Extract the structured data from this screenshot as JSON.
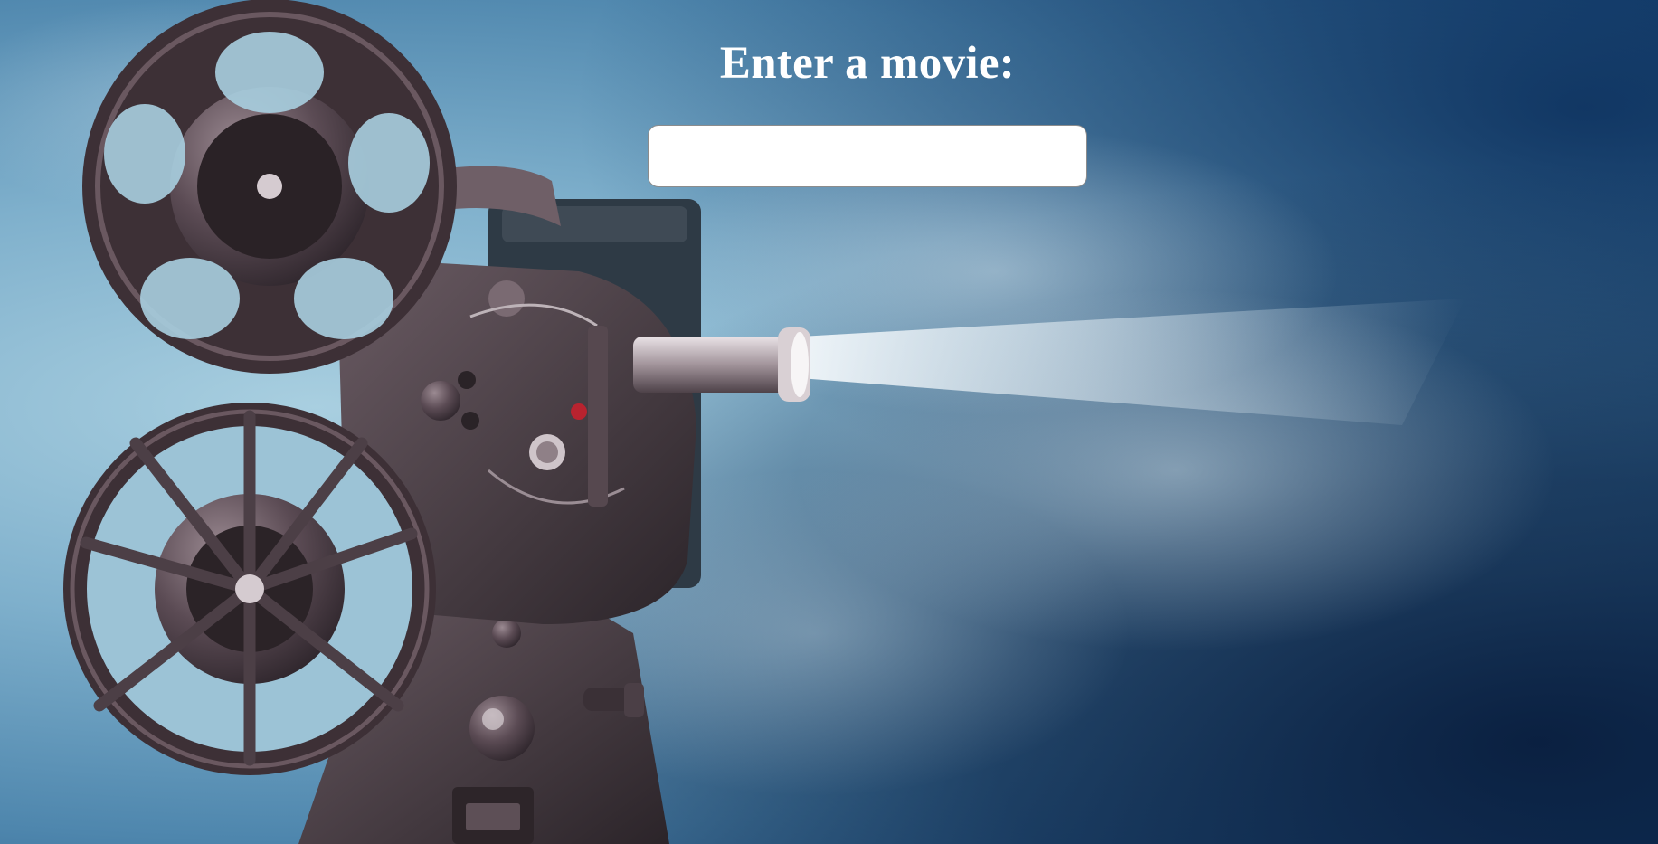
{
  "page": {
    "heading": "Enter a movie:"
  },
  "search": {
    "value": "",
    "placeholder": ""
  },
  "background": {
    "subject": "film-projector-photo",
    "colors": {
      "haze": "#8fbfd6",
      "deep_blue": "#0d2f5c",
      "metal": "#4a3d44",
      "beam": "#e7eef3"
    }
  }
}
